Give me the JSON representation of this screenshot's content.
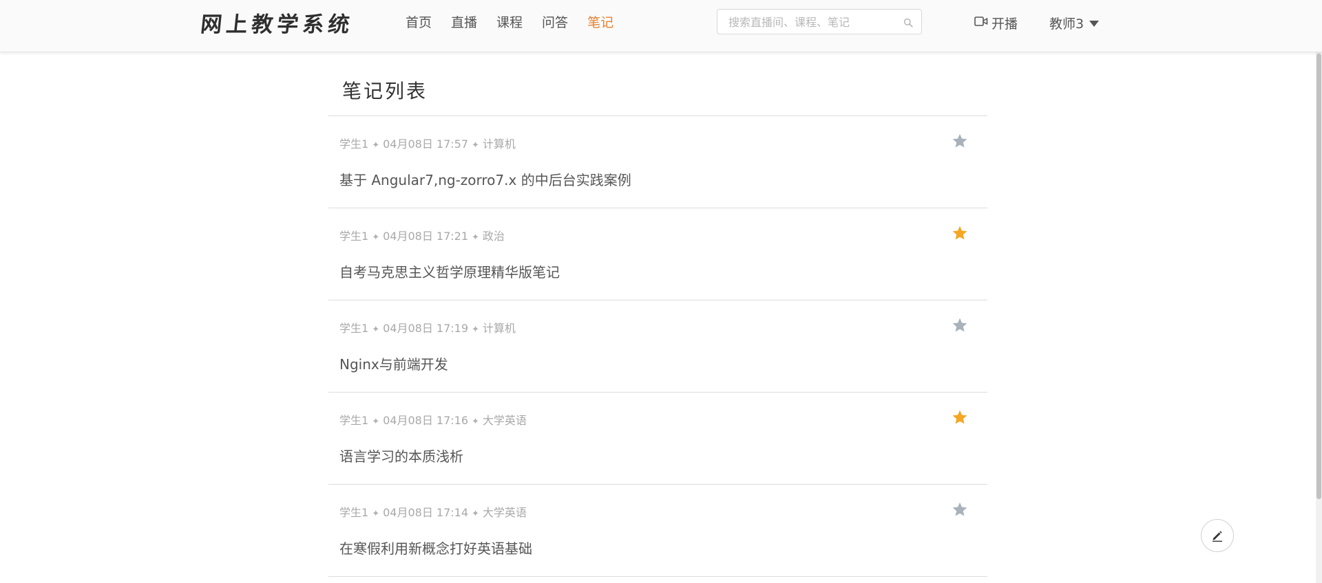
{
  "header": {
    "logo": "网上教学系统",
    "nav": [
      {
        "label": "首页",
        "active": false
      },
      {
        "label": "直播",
        "active": false
      },
      {
        "label": "课程",
        "active": false
      },
      {
        "label": "问答",
        "active": false
      },
      {
        "label": "笔记",
        "active": true
      }
    ],
    "search": {
      "placeholder": "搜索直播间、课程、笔记",
      "value": "",
      "icon": "search-icon"
    },
    "live_button": {
      "label": "开播",
      "icon": "video-camera-icon"
    },
    "user": {
      "name": "教师3",
      "icon": "caret-down-icon"
    }
  },
  "main": {
    "title": "笔记列表",
    "separator": "✦",
    "notes": [
      {
        "author": "学生1",
        "time": "04月08日 17:57",
        "category": "计算机",
        "title": "基于 Angular7,ng-zorro7.x 的中后台实践案例",
        "starred": false
      },
      {
        "author": "学生1",
        "time": "04月08日 17:21",
        "category": "政治",
        "title": "自考马克思主义哲学原理精华版笔记",
        "starred": true
      },
      {
        "author": "学生1",
        "time": "04月08日 17:19",
        "category": "计算机",
        "title": "Nginx与前端开发",
        "starred": false
      },
      {
        "author": "学生1",
        "time": "04月08日 17:16",
        "category": "大学英语",
        "title": "语言学习的本质浅析",
        "starred": true
      },
      {
        "author": "学生1",
        "time": "04月08日 17:14",
        "category": "大学英语",
        "title": "在寒假利用新概念打好英语基础",
        "starred": false
      }
    ]
  },
  "fab": {
    "icon": "pencil-icon"
  },
  "colors": {
    "accent": "#e8812f",
    "star_active": "#f5a623",
    "star_inactive": "#a9b1bb",
    "meta_text": "#a8a8a8",
    "divider": "#dcdcdc"
  }
}
